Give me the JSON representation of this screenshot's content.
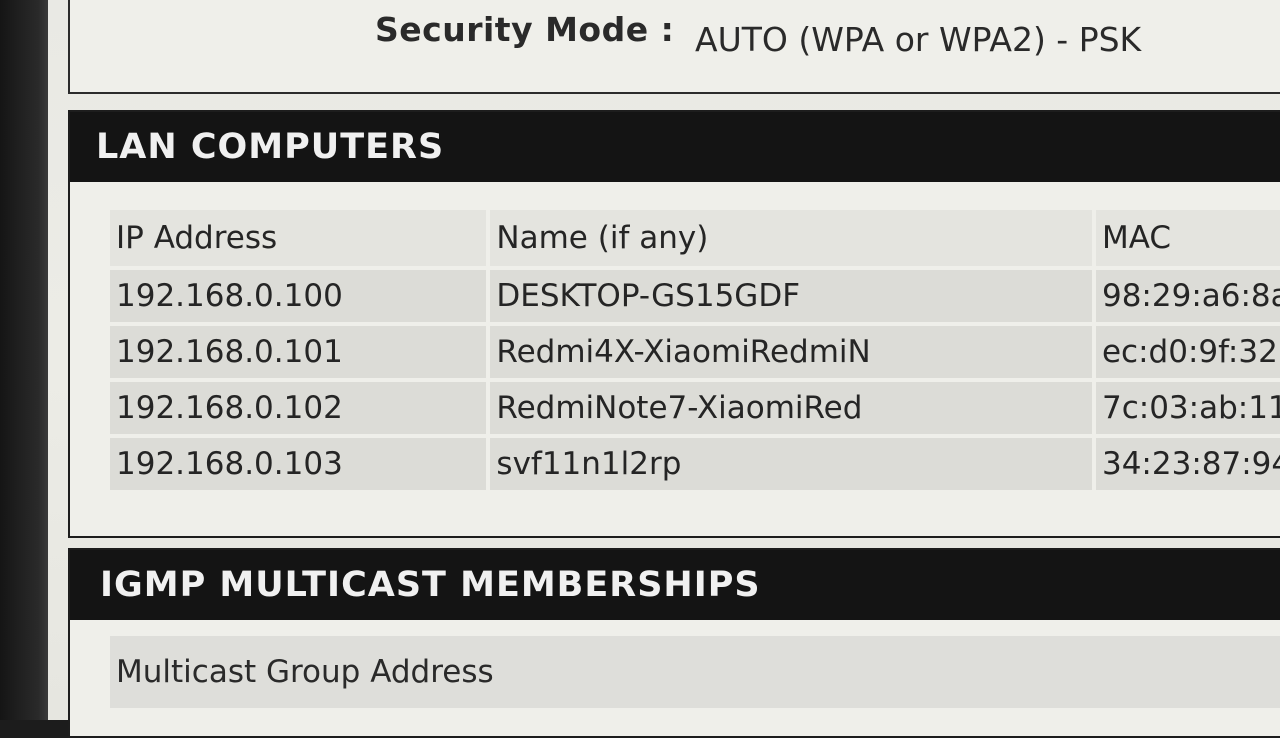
{
  "security": {
    "label": "Security Mode :",
    "value": "AUTO (WPA or WPA2) - PSK"
  },
  "lan": {
    "title": "LAN COMPUTERS",
    "columns": [
      "IP Address",
      "Name (if any)",
      "MAC"
    ],
    "rows": [
      {
        "ip": "192.168.0.100",
        "name": "DESKTOP-GS15GDF",
        "mac": "98:29:a6:8a"
      },
      {
        "ip": "192.168.0.101",
        "name": "Redmi4X-XiaomiRedmiN",
        "mac": "ec:d0:9f:32:"
      },
      {
        "ip": "192.168.0.102",
        "name": "RedmiNote7-XiaomiRed",
        "mac": "7c:03:ab:11:"
      },
      {
        "ip": "192.168.0.103",
        "name": "svf11n1l2rp",
        "mac": "34:23:87:94:"
      }
    ]
  },
  "igmp": {
    "title": "IGMP MULTICAST MEMBERSHIPS",
    "column": "Multicast Group Address"
  }
}
